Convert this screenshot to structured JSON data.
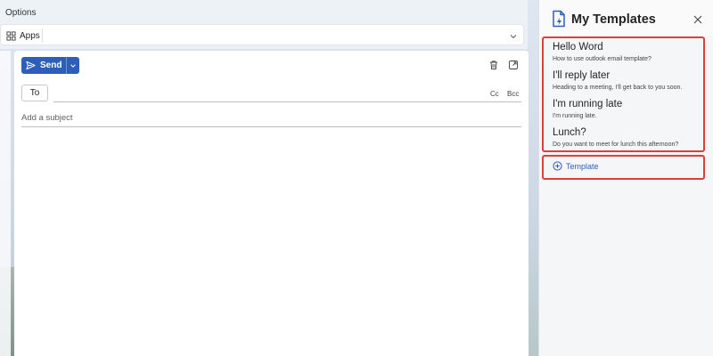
{
  "ribbon": {
    "title": "Options",
    "apps_label": "Apps"
  },
  "compose": {
    "send_label": "Send",
    "to_label": "To",
    "cc_label": "Cc",
    "bcc_label": "Bcc",
    "subject_placeholder": "Add a subject"
  },
  "panel": {
    "title": "My Templates",
    "templates": [
      {
        "name": "Hello Word",
        "description": "How to use outlook email template?"
      },
      {
        "name": "I'll reply later",
        "description": "Heading to a meeting, I'll get back to you soon."
      },
      {
        "name": "I'm running late",
        "description": "I'm running late."
      },
      {
        "name": "Lunch?",
        "description": "Do you want to meet for lunch this afternoon?"
      }
    ],
    "add_label": "Template"
  },
  "colors": {
    "accent": "#2e5fb8",
    "highlight_border": "#d9413d"
  },
  "icons": [
    "apps-icon",
    "chevron-down-icon",
    "send-icon",
    "delete-icon",
    "popout-icon",
    "template-logo-icon",
    "close-icon",
    "add-circle-icon"
  ]
}
